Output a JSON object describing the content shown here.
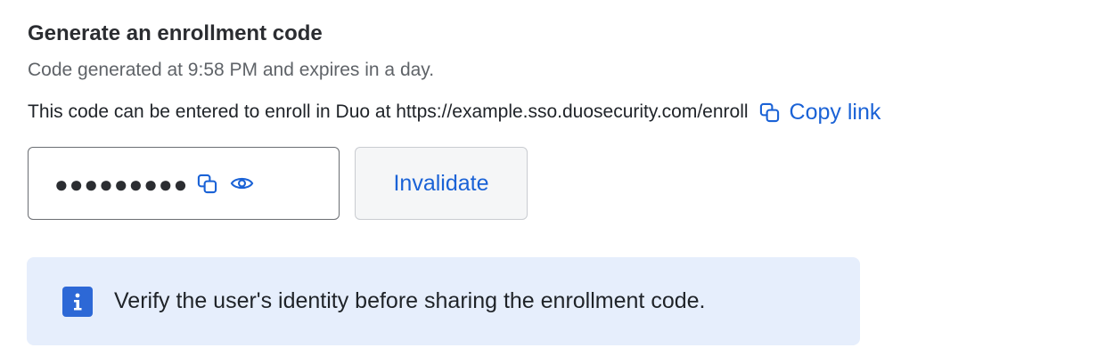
{
  "header": {
    "title": "Generate an enrollment code",
    "subtitle": "Code generated at 9:58 PM and expires in a day."
  },
  "enrollment": {
    "description": "This code can be entered to enroll in Duo at https://example.sso.duosecurity.com/enroll",
    "copy_link_label": "Copy link",
    "copy_link_icon": "copy-icon"
  },
  "code_field": {
    "masked_value": "●●●●●●●●●",
    "copy_icon": "copy-icon",
    "reveal_icon": "eye-icon"
  },
  "actions": {
    "invalidate_label": "Invalidate"
  },
  "notice": {
    "icon": "info-icon",
    "text": "Verify the user's identity before sharing the enrollment code."
  },
  "colors": {
    "accent": "#1a62d6",
    "notice_background": "#e6eefc",
    "info_icon_background": "#2d68d6"
  }
}
